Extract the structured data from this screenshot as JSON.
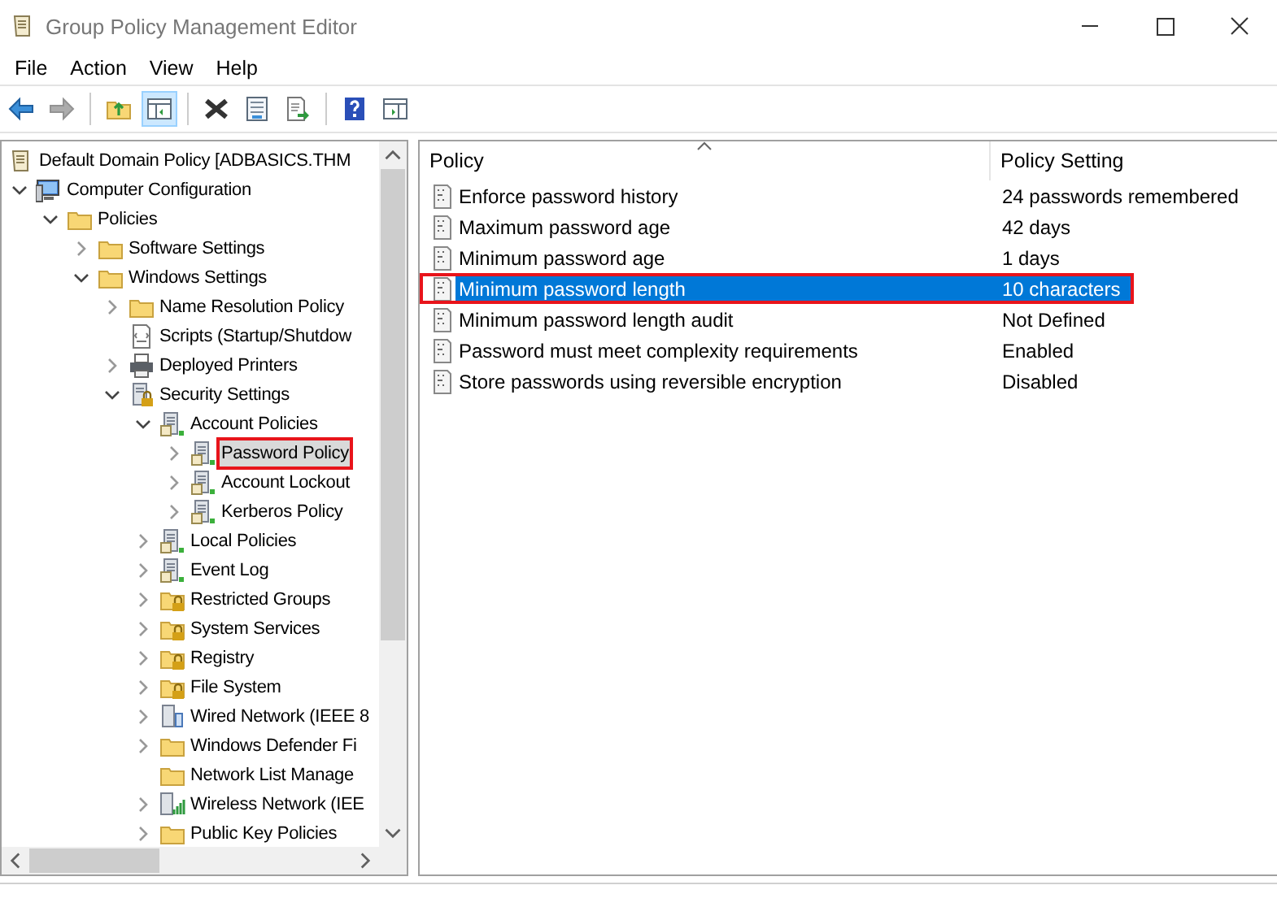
{
  "window": {
    "title": "Group Policy Management Editor"
  },
  "menu": [
    "File",
    "Action",
    "View",
    "Help"
  ],
  "toolbar": [
    {
      "pressed": false,
      "disabled": false
    },
    {
      "pressed": false,
      "disabled": true
    },
    {
      "pressed": false,
      "disabled": false
    },
    {
      "pressed": true,
      "disabled": false
    },
    {
      "pressed": false,
      "disabled": false
    },
    {
      "pressed": false,
      "disabled": false
    },
    {
      "pressed": false,
      "disabled": false
    },
    {
      "pressed": false,
      "disabled": false
    },
    {
      "pressed": false,
      "disabled": false
    }
  ],
  "tree": [
    {
      "label": "Default Domain Policy [ADBASICS.THM",
      "kind": "scroll",
      "selected": false,
      "highlighted": false,
      "children": [
        {
          "label": "Computer Configuration",
          "kind": "computer",
          "expanded": true,
          "selected": false,
          "highlighted": false,
          "children": [
            {
              "label": "Policies",
              "kind": "folder",
              "expanded": true,
              "selected": false,
              "highlighted": false,
              "children": [
                {
                  "label": "Software Settings",
                  "kind": "folder",
                  "expanded": false,
                  "selected": false,
                  "highlighted": false
                },
                {
                  "label": "Windows Settings",
                  "kind": "folder",
                  "expanded": true,
                  "selected": false,
                  "highlighted": false,
                  "children": [
                    {
                      "label": "Name Resolution Policy",
                      "kind": "folder",
                      "expanded": false,
                      "selected": false,
                      "highlighted": false
                    },
                    {
                      "label": "Scripts (Startup/Shutdow",
                      "kind": "script",
                      "selected": false,
                      "highlighted": false
                    },
                    {
                      "label": "Deployed Printers",
                      "kind": "printer",
                      "expanded": false,
                      "selected": false,
                      "highlighted": false
                    },
                    {
                      "label": "Security Settings",
                      "kind": "secure",
                      "expanded": true,
                      "selected": false,
                      "highlighted": false,
                      "children": [
                        {
                          "label": "Account Policies",
                          "kind": "server",
                          "expanded": true,
                          "selected": false,
                          "highlighted": false,
                          "children": [
                            {
                              "label": "Password Policy",
                              "kind": "server",
                              "expanded": false,
                              "selected": true,
                              "highlighted": true
                            },
                            {
                              "label": "Account Lockout",
                              "kind": "server",
                              "expanded": false,
                              "selected": false,
                              "highlighted": false
                            },
                            {
                              "label": "Kerberos Policy",
                              "kind": "server",
                              "expanded": false,
                              "selected": false,
                              "highlighted": false
                            }
                          ]
                        },
                        {
                          "label": "Local Policies",
                          "kind": "server",
                          "expanded": false,
                          "selected": false,
                          "highlighted": false
                        },
                        {
                          "label": "Event Log",
                          "kind": "server",
                          "expanded": false,
                          "selected": false,
                          "highlighted": false
                        },
                        {
                          "label": "Restricted Groups",
                          "kind": "lockfolder",
                          "expanded": false,
                          "selected": false,
                          "highlighted": false
                        },
                        {
                          "label": "System Services",
                          "kind": "lockfolder",
                          "expanded": false,
                          "selected": false,
                          "highlighted": false
                        },
                        {
                          "label": "Registry",
                          "kind": "lockfolder",
                          "expanded": false,
                          "selected": false,
                          "highlighted": false
                        },
                        {
                          "label": "File System",
                          "kind": "lockfolder",
                          "expanded": false,
                          "selected": false,
                          "highlighted": false
                        },
                        {
                          "label": "Wired Network (IEEE 8",
                          "kind": "network",
                          "expanded": false,
                          "selected": false,
                          "highlighted": false
                        },
                        {
                          "label": "Windows Defender Fi",
                          "kind": "folder",
                          "expanded": false,
                          "selected": false,
                          "highlighted": false
                        },
                        {
                          "label": "Network List Manage",
                          "kind": "folder",
                          "selected": false,
                          "highlighted": false
                        },
                        {
                          "label": "Wireless Network (IEE",
                          "kind": "wireless",
                          "expanded": false,
                          "selected": false,
                          "highlighted": false
                        },
                        {
                          "label": "Public Key Policies",
                          "kind": "folder",
                          "expanded": false,
                          "selected": false,
                          "highlighted": false
                        }
                      ]
                    }
                  ]
                }
              ]
            }
          ]
        }
      ]
    }
  ],
  "table": {
    "columns": [
      "Policy",
      "Policy Setting"
    ],
    "rows": [
      {
        "policy": "Enforce password history",
        "setting": "24 passwords remembered",
        "selected": false,
        "highlighted": false
      },
      {
        "policy": "Maximum password age",
        "setting": "42 days",
        "selected": false,
        "highlighted": false
      },
      {
        "policy": "Minimum password age",
        "setting": "1 days",
        "selected": false,
        "highlighted": false
      },
      {
        "policy": "Minimum password length",
        "setting": "10 characters",
        "selected": true,
        "highlighted": true
      },
      {
        "policy": "Minimum password length audit",
        "setting": "Not Defined",
        "selected": false,
        "highlighted": false
      },
      {
        "policy": "Password must meet complexity requirements",
        "setting": "Enabled",
        "selected": false,
        "highlighted": false
      },
      {
        "policy": "Store passwords using reversible encryption",
        "setting": "Disabled",
        "selected": false,
        "highlighted": false
      }
    ]
  }
}
